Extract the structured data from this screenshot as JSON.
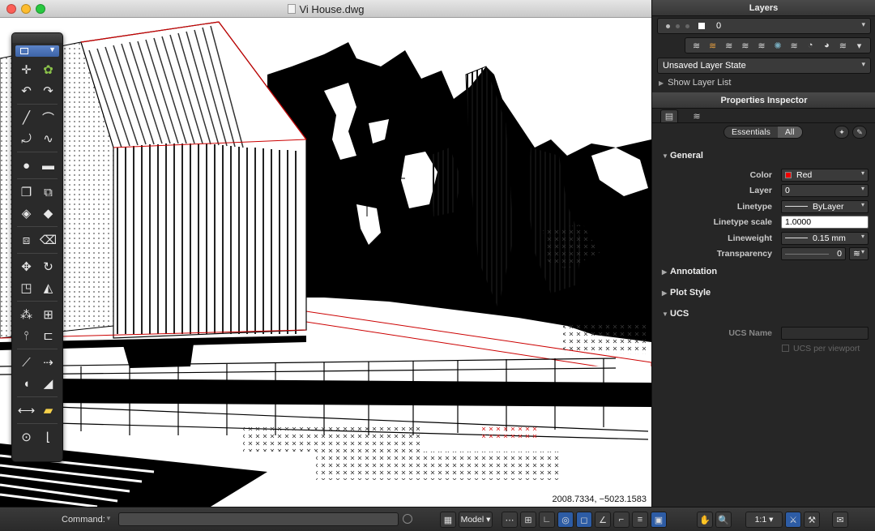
{
  "window": {
    "title": "Vi House.dwg"
  },
  "canvas": {
    "coordinates": "2008.7334, −5023.1583"
  },
  "toolbox": {
    "tools": [
      [
        "point-tool",
        "paint-tool"
      ],
      [
        "undo-tool",
        "redo-tool"
      ],
      [
        "line-tool",
        "arc-tool"
      ],
      [
        "polyline-tool",
        "spline-tool"
      ],
      [
        "circle-tool",
        "rectangle-tool"
      ],
      [
        "block-tool",
        "insert-tool"
      ],
      [
        "hatch-tool",
        "fill-tool"
      ],
      [
        "group-tool",
        "eraser-tool"
      ],
      [
        "move-tool",
        "rotate-tool"
      ],
      [
        "scale-tool",
        "stretch-tool"
      ],
      [
        "copy-tool",
        "array-tool"
      ],
      [
        "mirror-tool",
        "offset-tool"
      ],
      [
        "trim-tool",
        "extend-tool"
      ],
      [
        "fillet-tool",
        "chamfer-tool"
      ],
      [
        "dimension-tool",
        "leader-tool"
      ],
      [
        "measure-tool",
        "ucs-tool"
      ]
    ]
  },
  "layers_panel": {
    "title": "Layers",
    "current_layer": "0",
    "layer_state": "Unsaved Layer State",
    "show_layer_list": "Show Layer List"
  },
  "properties": {
    "title": "Properties Inspector",
    "segment": {
      "essentials": "Essentials",
      "all": "All"
    },
    "sections": {
      "general": "General",
      "annotation": "Annotation",
      "plot_style": "Plot Style",
      "ucs": "UCS"
    },
    "fields": {
      "color_label": "Color",
      "color_value": "Red",
      "color_hex": "#e00000",
      "layer_label": "Layer",
      "layer_value": "0",
      "linetype_label": "Linetype",
      "linetype_value": "ByLayer",
      "linetype_scale_label": "Linetype scale",
      "linetype_scale_value": "1.0000",
      "lineweight_label": "Lineweight",
      "lineweight_value": "0.15 mm",
      "transparency_label": "Transparency",
      "transparency_value": "0",
      "ucs_name_label": "UCS Name",
      "ucs_per_viewport": "UCS per viewport"
    }
  },
  "statusbar": {
    "command_label": "Command:",
    "model_label": "Model",
    "scale_label": "1:1"
  },
  "colors": {
    "accent": "#2d5ca5",
    "selection_red": "#e00000"
  }
}
